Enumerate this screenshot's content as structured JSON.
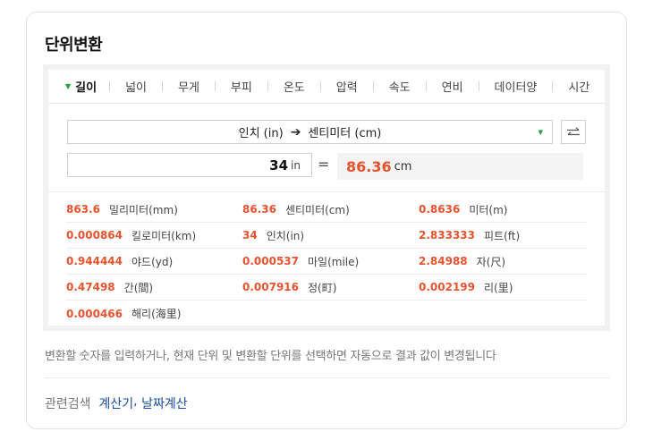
{
  "widget": {
    "title": "단위변환",
    "tabs": [
      "길이",
      "넓이",
      "무게",
      "부피",
      "온도",
      "압력",
      "속도",
      "연비",
      "데이터양",
      "시간"
    ],
    "active_tab": "길이",
    "selector": {
      "from": "인치 (in)",
      "to": "센티미터 (cm)"
    },
    "input": {
      "value": "34",
      "unit": "in"
    },
    "equals": "=",
    "result": {
      "value": "86.36",
      "unit": "cm"
    },
    "conversions": [
      [
        {
          "value": "863.6",
          "name": "밀리미터(mm)"
        },
        {
          "value": "86.36",
          "name": "센티미터(cm)"
        },
        {
          "value": "0.8636",
          "name": "미터(m)"
        }
      ],
      [
        {
          "value": "0.000864",
          "name": "킬로미터(km)"
        },
        {
          "value": "34",
          "name": "인치(in)"
        },
        {
          "value": "2.833333",
          "name": "피트(ft)"
        }
      ],
      [
        {
          "value": "0.944444",
          "name": "야드(yd)"
        },
        {
          "value": "0.000537",
          "name": "마일(mile)"
        },
        {
          "value": "2.84988",
          "name": "자(尺)"
        }
      ],
      [
        {
          "value": "0.47498",
          "name": "간(間)"
        },
        {
          "value": "0.007916",
          "name": "정(町)"
        },
        {
          "value": "0.002199",
          "name": "리(里)"
        }
      ],
      [
        {
          "value": "0.000466",
          "name": "해리(海里)"
        }
      ]
    ],
    "description": "변환할 숫자를 입력하거나, 현재 단위 및 변환할 단위를 선택하면 자동으로 결과 값이 변경됩니다",
    "related": {
      "label": "관련검색",
      "links": [
        "계산기",
        "날짜계산"
      ]
    }
  },
  "icons": {
    "tab_active": "triangle-down-icon",
    "selector_arrow": "arrow-right-icon",
    "dropdown": "triangle-down-icon",
    "swap": "swap-arrows-icon"
  },
  "colors": {
    "accent": "#e5532f",
    "green": "#1aa038",
    "link": "#1a4da1"
  }
}
